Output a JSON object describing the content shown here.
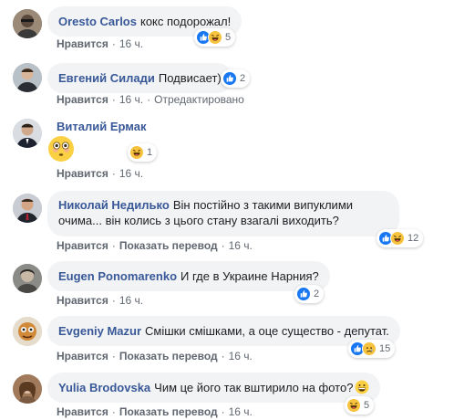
{
  "actions": {
    "like": "Нравится",
    "translate": "Показать перевод",
    "edited": "Отредактировано",
    "separator": "·"
  },
  "colors": {
    "author": "#385898",
    "bubble": "#f2f3f5",
    "like_blue": "#1877f2",
    "emoji_yellow": "#f7c23e"
  },
  "comments": [
    {
      "author": "Oresto Carlos",
      "text": "кокс подорожал!",
      "time": "16 ч.",
      "reactions": {
        "icons": [
          "like-icon",
          "haha-icon"
        ],
        "count": "5"
      }
    },
    {
      "author": "Евгений Силади",
      "text": "Подвисает)",
      "time": "16 ч.",
      "edited": true,
      "reactions": {
        "icons": [
          "like-icon"
        ],
        "count": "2"
      }
    },
    {
      "author": "Виталий Ермак",
      "text": "",
      "sticker": "flushed-emoji",
      "time": "16 ч.",
      "reactions": {
        "icons": [
          "haha-icon"
        ],
        "count": "1"
      }
    },
    {
      "author": "Николай Недилько",
      "text": "Він постійно з такими випуклими очима... він колись з цього стану взагалі виходить?",
      "time": "16 ч.",
      "translate": true,
      "reactions": {
        "icons": [
          "like-icon",
          "haha-icon"
        ],
        "count": "12"
      }
    },
    {
      "author": "Eugen Ponomarenko",
      "text": "И где в Украине Нарния?",
      "time": "16 ч.",
      "reactions": {
        "icons": [
          "like-icon"
        ],
        "count": "2"
      }
    },
    {
      "author": "Evgeniy Mazur",
      "text": "Смішки смішками, а оце существо - депутат.",
      "time": "16 ч.",
      "translate": true,
      "reactions": {
        "icons": [
          "like-icon",
          "sad-icon"
        ],
        "count": "15"
      }
    },
    {
      "author": "Yulia Brodovska",
      "text": "Чим це його так вштирило на фото?",
      "inline_emoji": "grinning-emoji",
      "time": "16 ч.",
      "translate": true,
      "reactions": {
        "icons": [
          "haha-icon"
        ],
        "count": "5"
      }
    }
  ]
}
